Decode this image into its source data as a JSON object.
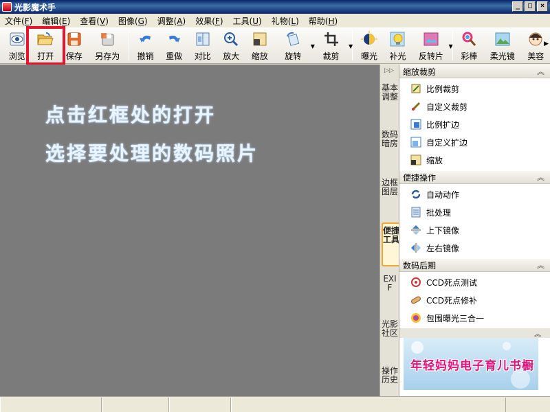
{
  "window": {
    "title": "光影魔术手"
  },
  "menu": [
    {
      "label": "文件",
      "key": "F"
    },
    {
      "label": "编辑",
      "key": "E"
    },
    {
      "label": "查看",
      "key": "V"
    },
    {
      "label": "图像",
      "key": "G"
    },
    {
      "label": "调整",
      "key": "A"
    },
    {
      "label": "效果",
      "key": "F"
    },
    {
      "label": "工具",
      "key": "U"
    },
    {
      "label": "礼物",
      "key": "L"
    },
    {
      "label": "帮助",
      "key": "H"
    }
  ],
  "toolbar": {
    "browse": "浏览",
    "open": "打开",
    "save": "保存",
    "save_as": "另存为",
    "undo": "撤销",
    "redo": "重做",
    "compare": "对比",
    "zoom_in": "放大",
    "resize": "缩放",
    "rotate": "旋转",
    "crop": "裁剪",
    "exposure": "曝光",
    "fill_light": "补光",
    "invert": "反转片",
    "color_pen": "彩棒",
    "soft_focus": "柔光镜",
    "beauty": "美容"
  },
  "canvas": {
    "hint_line1": "点击红框处的打开",
    "hint_line2": "选择要处理的数码照片"
  },
  "vtabs": [
    "基本调整",
    "数码暗房",
    "边框图层",
    "便捷工具",
    "EXIF",
    "光影社区",
    "操作历史"
  ],
  "panel": {
    "sections": [
      {
        "title": "缩放裁剪",
        "items": [
          "比例裁剪",
          "自定义裁剪",
          "比例扩边",
          "自定义扩边",
          "缩放"
        ]
      },
      {
        "title": "便捷操作",
        "items": [
          "自动动作",
          "批处理",
          "上下镜像",
          "左右镜像"
        ]
      },
      {
        "title": "数码后期",
        "items": [
          "CCD死点测试",
          "CCD死点修补",
          "包围曝光三合一"
        ]
      }
    ],
    "ad_text": "年轻妈妈电子育儿书橱"
  },
  "colors": {
    "highlight": "#e8132c",
    "canvas": "#7b7b7b",
    "title_bar": "#0a246a"
  }
}
